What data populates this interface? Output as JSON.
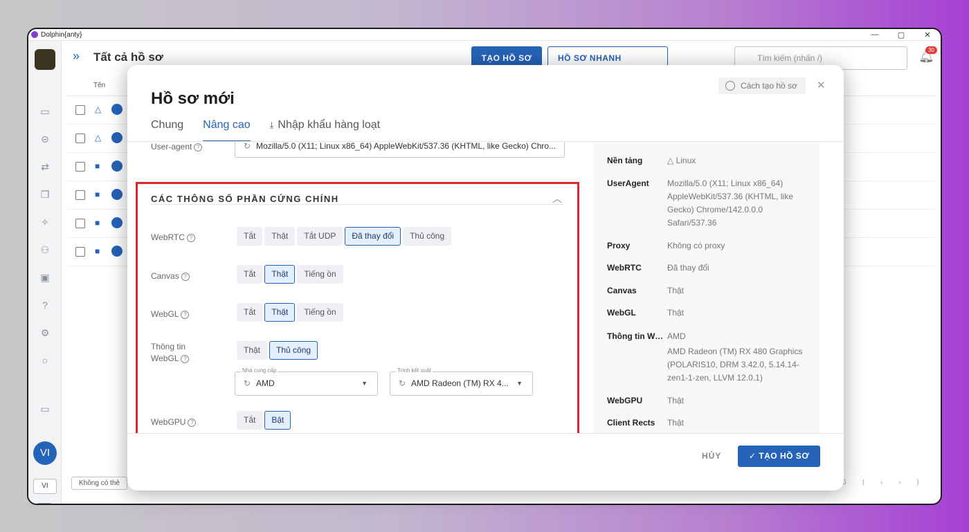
{
  "window": {
    "title": "Dolphin{anty}",
    "controls": [
      "—",
      "▢",
      "✕"
    ]
  },
  "topbar": {
    "page_title": "Tất cả hồ sơ",
    "create_btn": "TẠO HỒ SƠ",
    "quick_btn": "HỒ SƠ NHANH",
    "search_placeholder": "Tìm kiếm (nhấn /)",
    "notifications": "30"
  },
  "list": {
    "header_name": "Tên",
    "filter_chip": "Không có thẻ",
    "page_count": "6"
  },
  "sidebar": {
    "avatar": "VI",
    "lang": "VI"
  },
  "modal": {
    "title": "Hồ sơ mới",
    "howto": "Cách tạo hồ sơ",
    "tabs": [
      "Chung",
      "Nâng cao",
      "Nhập khẩu hàng loạt"
    ],
    "useragent_label": "User-agent",
    "useragent_value": "Mozilla/5.0 (X11; Linux x86_64) AppleWebKit/537.36 (KHTML, like Gecko) Chro...",
    "section_title": "CÁC THÔNG SỐ PHẦN CỨNG CHÍNH",
    "webrtc": {
      "label": "WebRTC",
      "options": [
        "Tắt",
        "Thật",
        "Tắt UDP",
        "Đã thay đổi",
        "Thủ công"
      ],
      "selected": 3
    },
    "canvas": {
      "label": "Canvas",
      "options": [
        "Tắt",
        "Thật",
        "Tiếng ồn"
      ],
      "selected": 1
    },
    "webgl": {
      "label": "WebGL",
      "options": [
        "Tắt",
        "Thật",
        "Tiếng ồn"
      ],
      "selected": 1
    },
    "webgl_info": {
      "label_line1": "Thông tin",
      "label_line2": "WebGL",
      "options": [
        "Thật",
        "Thủ công"
      ],
      "selected": 1,
      "vendor_label": "Nhà cung cấp",
      "vendor_value": "AMD",
      "renderer_label": "Trình kết xuất",
      "renderer_value": "AMD Radeon (TM) RX 4..."
    },
    "webgpu": {
      "label": "WebGPU",
      "options": [
        "Tắt",
        "Bật"
      ],
      "selected": 1
    },
    "summary": [
      {
        "key": "Nền tảng",
        "value": "Linux"
      },
      {
        "key": "UserAgent",
        "value": "Mozilla/5.0 (X11; Linux x86_64) AppleWebKit/537.36 (KHTML, like Gecko) Chrome/142.0.0.0 Safari/537.36"
      },
      {
        "key": "Proxy",
        "value": "Không có proxy"
      },
      {
        "key": "WebRTC",
        "value": "Đã thay đổi"
      },
      {
        "key": "Canvas",
        "value": "Thật"
      },
      {
        "key": "WebGL",
        "value": "Thật"
      },
      {
        "key": "Thông tin We...",
        "value": "AMD"
      },
      {
        "key": "",
        "value": "AMD Radeon (TM) RX 480 Graphics (POLARIS10, DRM 3.42.0, 5.14.14-zen1-1-zen, LLVM 12.0.1)"
      },
      {
        "key": "WebGPU",
        "value": "Thật"
      },
      {
        "key": "Client Rects",
        "value": "Thật"
      }
    ],
    "cancel": "HỦY",
    "submit": "TẠO HỒ SƠ"
  },
  "colors": {
    "accent": "#2563b8",
    "highlight_box": "#e0252d"
  }
}
